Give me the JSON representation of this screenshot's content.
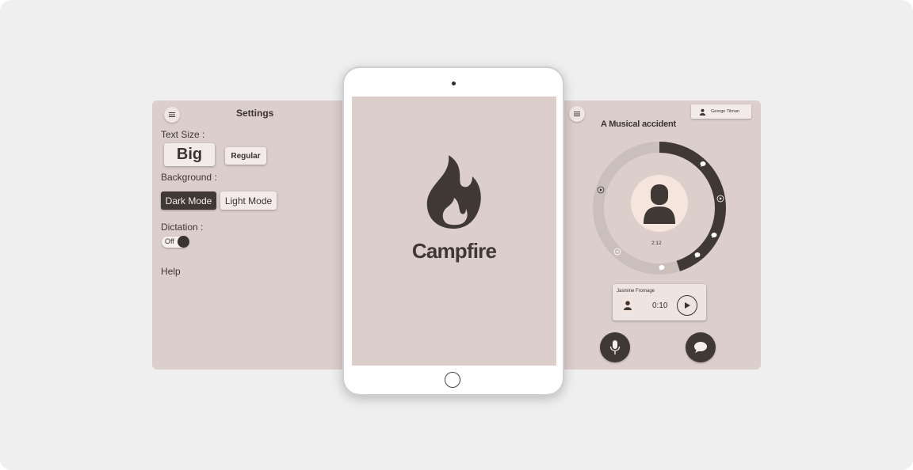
{
  "settings": {
    "title": "Settings",
    "text_size_label": "Text Size :",
    "size_big": "Big",
    "size_regular": "Regular",
    "background_label": "Background :",
    "dark_mode": "Dark Mode",
    "light_mode": "Light Mode",
    "dictation_label": "Dictation :",
    "dictation_state": "Off",
    "help": "Help"
  },
  "splash": {
    "app_name": "Campfire",
    "logo_icon": "flame-icon"
  },
  "player": {
    "user_name": "George Tilman",
    "track_title": "A Musical accident",
    "elapsed": "2:12",
    "progress": 0.45,
    "message": {
      "author": "Jasmine Fromage",
      "duration": "0:10"
    },
    "mic_icon": "microphone-icon",
    "chat_icon": "chat-bubble-icon"
  },
  "colors": {
    "background": "#efefef",
    "panel": "#dccfcb",
    "dark": "#3f3835",
    "light": "#f3ebe9",
    "avatar_bg": "#f5e5dd"
  }
}
